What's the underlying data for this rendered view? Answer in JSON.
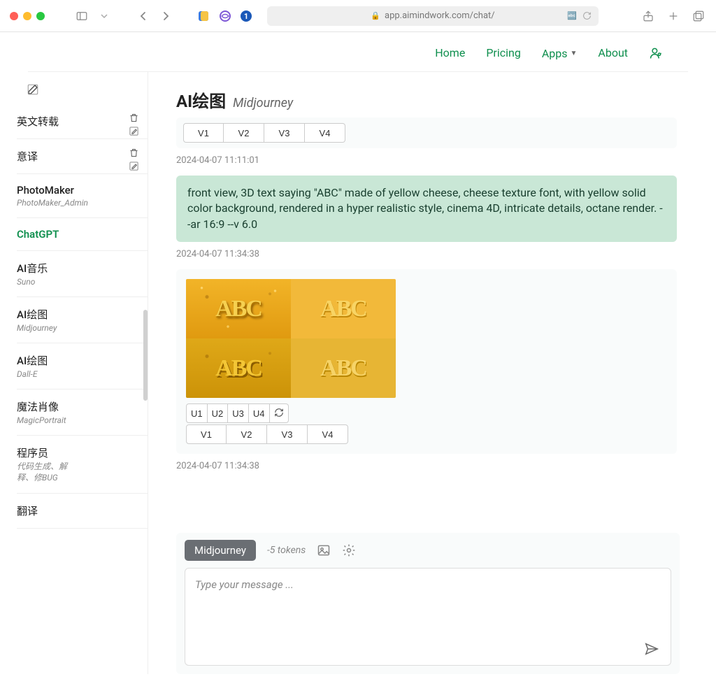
{
  "browser": {
    "url": "app.aimindwork.com/chat/"
  },
  "nav": {
    "home": "Home",
    "pricing": "Pricing",
    "apps": "Apps",
    "about": "About"
  },
  "sidebar": {
    "items": [
      {
        "title": "英文转载",
        "sub": "",
        "actions": true
      },
      {
        "title": "意译",
        "sub": "",
        "actions": true
      },
      {
        "title": "PhotoMaker",
        "sub": "PhotoMaker_Admin"
      },
      {
        "title": "ChatGPT",
        "sub": "",
        "active": true
      },
      {
        "title": "AI音乐",
        "sub": "Suno"
      },
      {
        "title": "AI绘图",
        "sub": "Midjourney"
      },
      {
        "title": "AI绘图",
        "sub": "Dall-E"
      },
      {
        "title": "魔法肖像",
        "sub": "MagicPortrait"
      },
      {
        "title": "程序员",
        "sub": "代码生成、解释、修BUG"
      },
      {
        "title": "翻译",
        "sub": ""
      }
    ]
  },
  "main": {
    "title": "AI绘图",
    "tag": "Midjourney",
    "top_row": {
      "v1": "V1",
      "v2": "V2",
      "v3": "V3",
      "v4": "V4"
    },
    "ts1": "2024-04-07 11:11:01",
    "user_prompt": "front view, 3D text saying \"ABC\" made of yellow cheese, cheese texture font, with yellow solid color background, rendered in a hyper realistic style, cinema 4D, intricate details, octane render. --ar 16:9 --v 6.0",
    "ts2": "2024-04-07 11:34:38",
    "abc": "ABC",
    "urow": {
      "u1": "U1",
      "u2": "U2",
      "u3": "U3",
      "u4": "U4"
    },
    "vrow": {
      "v1": "V1",
      "v2": "V2",
      "v3": "V3",
      "v4": "V4"
    },
    "ts3": "2024-04-07 11:34:38",
    "composer_pill": "Midjourney",
    "tokens": "-5 tokens",
    "placeholder": "Type your message ..."
  }
}
